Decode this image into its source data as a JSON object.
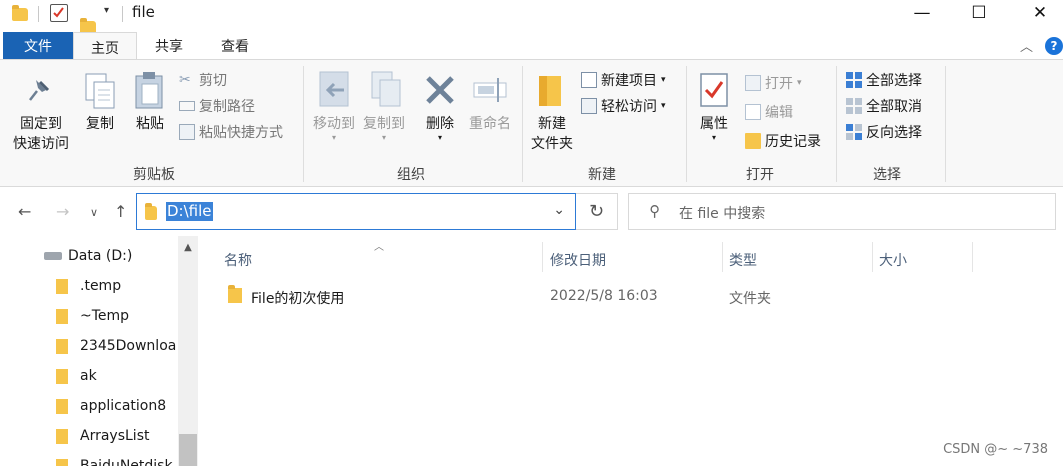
{
  "window": {
    "title": "file",
    "controls": {
      "minimize": "—",
      "maximize": "☐",
      "close": "✕"
    }
  },
  "tabs": [
    "文件",
    "主页",
    "共享",
    "查看"
  ],
  "ribbon": {
    "clipboard": {
      "label": "剪贴板",
      "pin": "固定到\n快速访问",
      "pin_line1": "固定到",
      "pin_line2": "快速访问",
      "copy": "复制",
      "paste": "粘贴",
      "cut": "剪切",
      "copy_path": "复制路径",
      "paste_shortcut": "粘贴快捷方式"
    },
    "organize": {
      "label": "组织",
      "move_to": "移动到",
      "copy_to": "复制到",
      "delete": "删除",
      "rename": "重命名"
    },
    "new": {
      "label": "新建",
      "new_folder_line1": "新建",
      "new_folder_line2": "文件夹",
      "new_item": "新建项目",
      "easy_access": "轻松访问"
    },
    "open": {
      "label": "打开",
      "properties": "属性",
      "open": "打开",
      "edit": "编辑",
      "history": "历史记录"
    },
    "select": {
      "label": "选择",
      "select_all": "全部选择",
      "select_none": "全部取消",
      "invert": "反向选择"
    }
  },
  "address": {
    "path": "D:\\file",
    "search_placeholder": "在 file 中搜索"
  },
  "nav_pane": {
    "drive": "Data (D:)",
    "folders": [
      ".temp",
      "~Temp",
      "2345Downloa",
      "ak",
      "application8",
      "ArraysList",
      "BaiduNetdisk"
    ]
  },
  "file_list": {
    "columns": [
      "名称",
      "修改日期",
      "类型",
      "大小"
    ],
    "rows": [
      {
        "name": "File的初次使用",
        "modified": "2022/5/8 16:03",
        "type": "文件夹",
        "size": ""
      }
    ]
  },
  "watermark": "CSDN @~ ~738",
  "colors": {
    "accent": "#1a63b4",
    "folder": "#f6c54a",
    "selection": "#3b83d8"
  }
}
